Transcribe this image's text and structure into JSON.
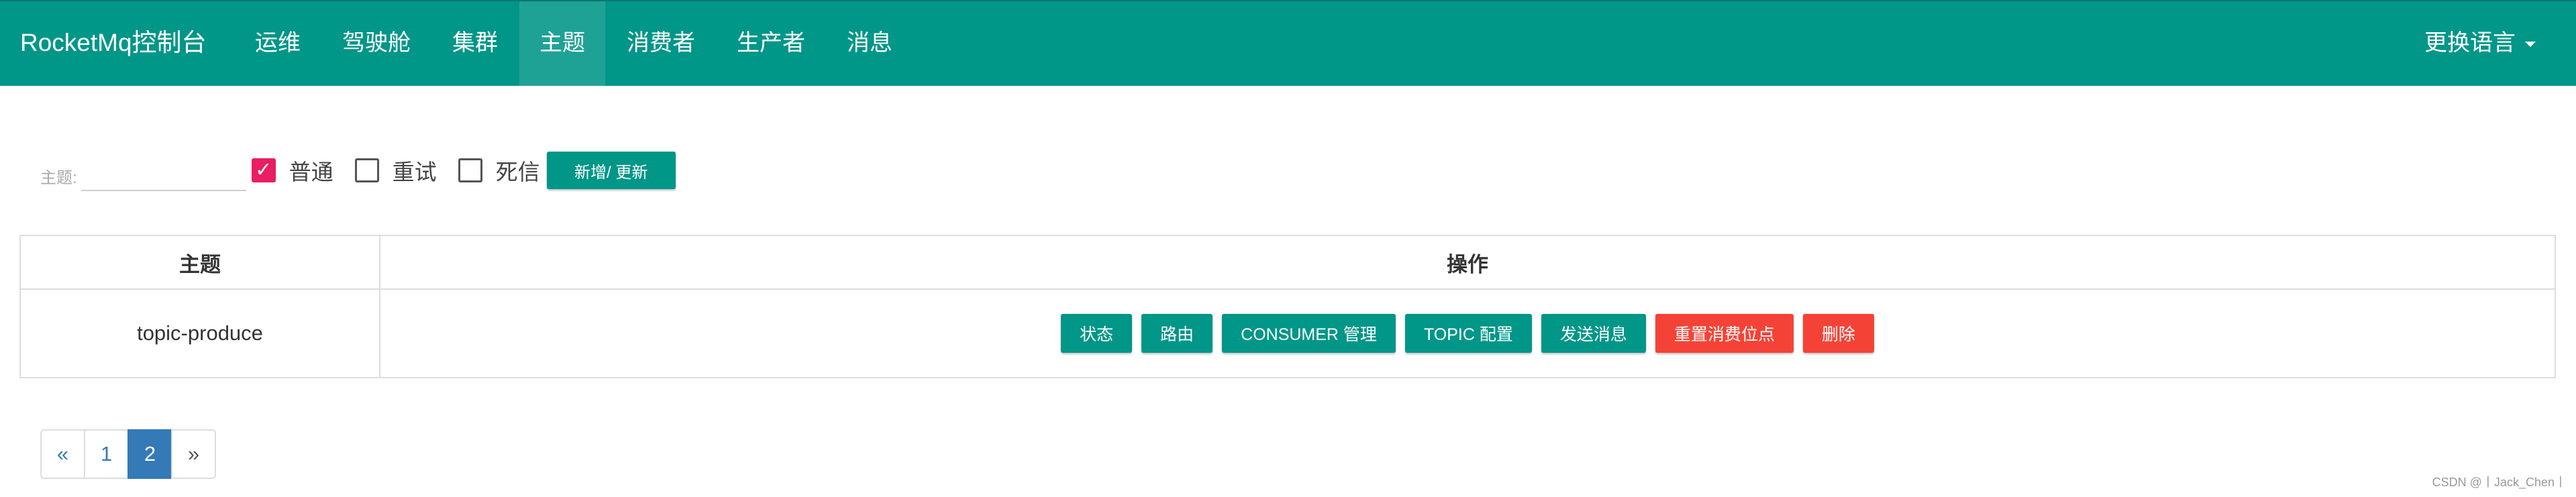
{
  "navbar": {
    "brand": "RocketMq控制台",
    "items": [
      {
        "label": "运维"
      },
      {
        "label": "驾驶舱"
      },
      {
        "label": "集群"
      },
      {
        "label": "主题",
        "active": true
      },
      {
        "label": "消费者"
      },
      {
        "label": "生产者"
      },
      {
        "label": "消息"
      }
    ],
    "language": "更换语言"
  },
  "filters": {
    "topic_label": "主题:",
    "topic_value": "",
    "normal": {
      "label": "普通",
      "checked": true
    },
    "retry": {
      "label": "重试",
      "checked": false
    },
    "dlq": {
      "label": "死信",
      "checked": false
    },
    "add_update": "新增/ 更新"
  },
  "table": {
    "headers": {
      "topic": "主题",
      "operation": "操作"
    },
    "rows": [
      {
        "topic": "topic-produce"
      }
    ],
    "actions": {
      "status": "状态",
      "router": "路由",
      "consumer_manage": "CONSUMER 管理",
      "topic_config": "TOPIC 配置",
      "send_message": "发送消息",
      "reset_offset": "重置消费位点",
      "delete": "删除"
    }
  },
  "pagination": {
    "prev": "«",
    "pages": [
      "1",
      "2"
    ],
    "current": "2",
    "next": "»"
  },
  "watermark": "CSDN @丨Jack_Chen丨",
  "colors": {
    "primary": "#009688",
    "danger": "#f44336",
    "checkbox": "#e91e63",
    "page_active": "#337ab7"
  }
}
